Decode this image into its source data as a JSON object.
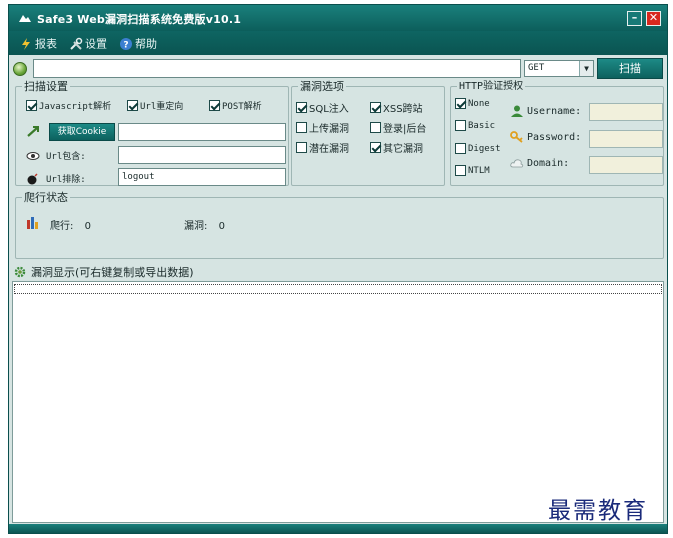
{
  "window": {
    "title": "Safe3 Web漏洞扫描系统免费版v10.1",
    "minimize_label": "–",
    "close_label": "✕",
    "accent_color": "#0d615e",
    "close_color": "#d8281e"
  },
  "menu": {
    "items": [
      {
        "label": "报表",
        "icon": "lightning-icon"
      },
      {
        "label": "设置",
        "icon": "tools-icon"
      },
      {
        "label": "帮助",
        "icon": "help-icon"
      }
    ]
  },
  "url_bar": {
    "url_value": "",
    "method": "GET",
    "scan_label": "扫描"
  },
  "scan_settings": {
    "legend": "扫描设置",
    "javascript_label": "Javascript解析",
    "javascript_checked": true,
    "redirect_label": "Url重定向",
    "redirect_checked": true,
    "post_label": "POST解析",
    "post_checked": true,
    "cookie_button": "获取Cookie",
    "cookie_value": "",
    "include_label": "Url包含:",
    "include_value": "",
    "exclude_label": "Url排除:",
    "exclude_value": "logout"
  },
  "vuln_options": {
    "legend": "漏洞选项",
    "items": [
      {
        "label": "SQL注入",
        "checked": true
      },
      {
        "label": "XSS跨站",
        "checked": true
      },
      {
        "label": "上传漏洞",
        "checked": false
      },
      {
        "label": "登录|后台",
        "checked": false
      },
      {
        "label": "潜在漏洞",
        "checked": false
      },
      {
        "label": "其它漏洞",
        "checked": true
      }
    ]
  },
  "http_auth": {
    "legend": "HTTP验证授权",
    "types": [
      {
        "label": "None",
        "checked": true
      },
      {
        "label": "Basic",
        "checked": false
      },
      {
        "label": "Digest",
        "checked": false
      },
      {
        "label": "NTLM",
        "checked": false
      }
    ],
    "username_label": "Username:",
    "password_label": "Password:",
    "domain_label": "Domain:",
    "username_value": "",
    "password_value": "",
    "domain_value": ""
  },
  "crawl_status": {
    "legend": "爬行状态",
    "crawl_label": "爬行:",
    "crawl_count": "0",
    "vuln_label": "漏洞:",
    "vuln_count": "0"
  },
  "results": {
    "header": "漏洞显示(可右键复制或导出数据)"
  },
  "watermark": "最需教育"
}
